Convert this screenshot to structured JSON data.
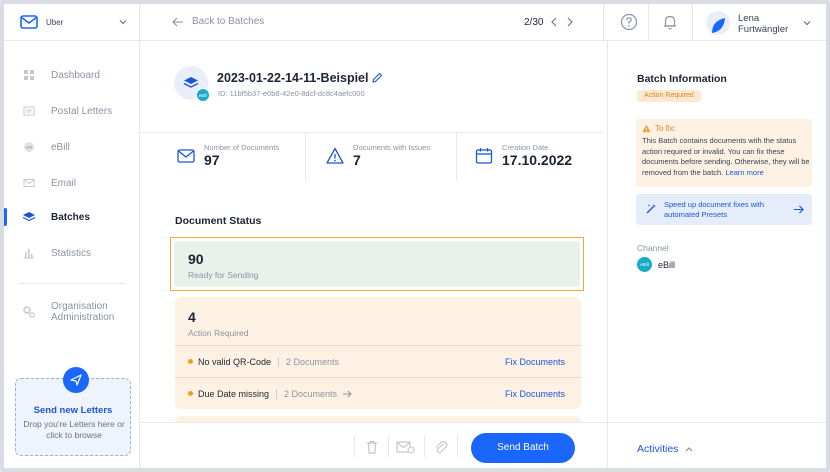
{
  "org": {
    "name": "Uber"
  },
  "nav": [
    {
      "label": "Dashboard",
      "icon": "dashboard-icon",
      "active": false
    },
    {
      "label": "Postal Letters",
      "icon": "letter-icon",
      "active": false
    },
    {
      "label": "eBill",
      "icon": "ebill-icon",
      "active": false
    },
    {
      "label": "Email",
      "icon": "mail-icon",
      "active": false
    },
    {
      "label": "Batches",
      "icon": "layers-icon",
      "active": true
    },
    {
      "label": "Statistics",
      "icon": "bar-chart-icon",
      "active": false
    }
  ],
  "nav_org_admin": {
    "line1": "Organisation",
    "line2": "Administration"
  },
  "send_box": {
    "title": "Send new Letters",
    "subtitle": "Drop you're Letters here or click to browse"
  },
  "topbar": {
    "back_label": "Back to Batches",
    "pager": "2/30",
    "user_first": "Lena",
    "user_last": "Furtwängler"
  },
  "batch": {
    "title": "2023-01-22-14-11-Beispiel",
    "id": "ID: 11bf5b37-e0b8-42e0-8dcf-dc8c4aefc000",
    "badge": "eBill"
  },
  "stats": [
    {
      "label": "Number of Documents",
      "value": "97",
      "icon": "envelope-icon"
    },
    {
      "label": "Documents with Issues",
      "value": "7",
      "icon": "warning-icon"
    },
    {
      "label": "Creation Date",
      "value": "17.10.2022",
      "icon": "calendar-icon"
    }
  ],
  "status": {
    "title": "Document Status",
    "ready": {
      "count": "90",
      "label": "Ready for Sending"
    },
    "action": {
      "count": "4",
      "label": "Action Required",
      "issues": [
        {
          "name": "No valid QR-Code",
          "count": "2 Documents",
          "fix": "Fix Documents"
        },
        {
          "name": "Due Date missing",
          "count": "2 Documents",
          "fix": "Fix Documents"
        }
      ]
    }
  },
  "bottom": {
    "send_label": "Send Batch"
  },
  "right": {
    "title": "Batch Information",
    "pill": "Action Required",
    "tofix_title": "To fix:",
    "tofix_text": "This Batch contains documents with the status action required or invalid. You can fix these documents before sending. Otherwise, they will be removed from the batch.",
    "learn_more": "Learn more",
    "presets_line1": "Speed up document fixes with",
    "presets_line2": "automated Presets",
    "channel_label": "Channel",
    "channel_value": "eBill",
    "channel_badge": "eBill",
    "activities": "Activities"
  },
  "colors": {
    "accent": "#1a66ff",
    "warning": "#ef9c2b",
    "ready_bg": "#e8f2ea",
    "action_bg": "#fdf1e4",
    "highlight_border": "#f0a93a"
  }
}
